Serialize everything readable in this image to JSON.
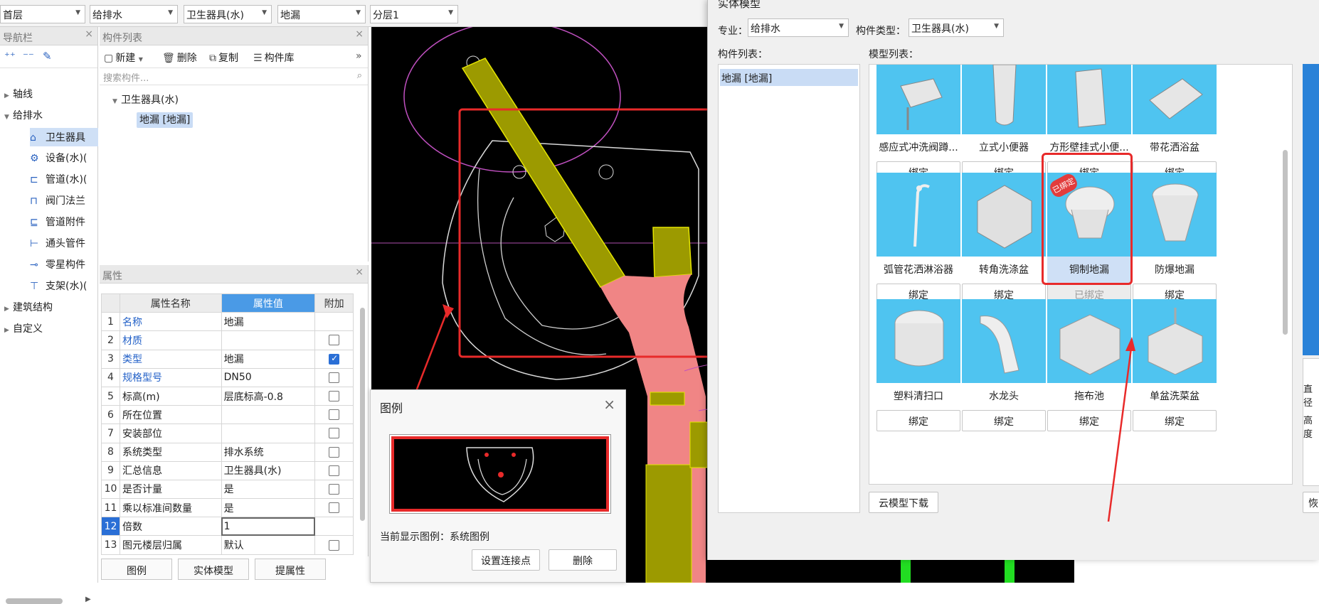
{
  "topbar": {
    "floor": "首层",
    "discipline": "给排水",
    "category": "卫生器具(水)",
    "component": "地漏",
    "sublayer": "分层1"
  },
  "nav": {
    "title": "导航栏",
    "items": [
      {
        "label": "轴线"
      },
      {
        "label": "给排水"
      },
      {
        "label": "卫生器具"
      },
      {
        "label": "设备(水)("
      },
      {
        "label": "管道(水)("
      },
      {
        "label": "阀门法兰"
      },
      {
        "label": "管道附件"
      },
      {
        "label": "通头管件"
      },
      {
        "label": "零星构件"
      },
      {
        "label": "支架(水)("
      },
      {
        "label": "建筑结构"
      },
      {
        "label": "自定义"
      }
    ]
  },
  "component_list": {
    "title": "构件列表",
    "new": "新建",
    "delete": "删除",
    "copy": "复制",
    "library": "构件库",
    "search_placeholder": "搜索构件...",
    "group": "卫生器具(水)",
    "item": "地漏 [地漏]"
  },
  "properties": {
    "title": "属性",
    "col_name": "属性名称",
    "col_value": "属性值",
    "col_extra": "附加",
    "rows": [
      {
        "no": "1",
        "name": "名称",
        "value": "地漏"
      },
      {
        "no": "2",
        "name": "材质",
        "value": ""
      },
      {
        "no": "3",
        "name": "类型",
        "value": "地漏"
      },
      {
        "no": "4",
        "name": "规格型号",
        "value": "DN50"
      },
      {
        "no": "5",
        "name": "标高(m)",
        "value": "层底标高-0.8"
      },
      {
        "no": "6",
        "name": "所在位置",
        "value": ""
      },
      {
        "no": "7",
        "name": "安装部位",
        "value": ""
      },
      {
        "no": "8",
        "name": "系统类型",
        "value": "排水系统"
      },
      {
        "no": "9",
        "name": "汇总信息",
        "value": "卫生器具(水)"
      },
      {
        "no": "10",
        "name": "是否计量",
        "value": "是"
      },
      {
        "no": "11",
        "name": "乘以标准间数量",
        "value": "是"
      },
      {
        "no": "12",
        "name": "倍数",
        "value": "1"
      },
      {
        "no": "13",
        "name": "图元楼层归属",
        "value": "默认"
      }
    ]
  },
  "bottom_tabs": {
    "legend": "图例",
    "entity": "实体模型",
    "extract": "提属性"
  },
  "legend_dialog": {
    "title": "图例",
    "current_prefix": "当前显示图例：",
    "current_value": "系统图例",
    "set_point": "设置连接点",
    "delete": "删除"
  },
  "model_dialog": {
    "title": "实体模型",
    "discipline_label": "专业：",
    "discipline_value": "给排水",
    "type_label": "构件类型：",
    "type_value": "卫生器具(水)",
    "list_label": "构件列表：",
    "model_label": "模型列表：",
    "list_item": "地漏 [地漏]",
    "cloud_download": "云模型下载",
    "side_label_1": "直径",
    "side_label_2": "高度",
    "side_button": "恢",
    "stamp": "已绑定",
    "models": [
      {
        "name": "感应式冲洗阀蹲...",
        "button": "绑定"
      },
      {
        "name": "立式小便器",
        "button": "绑定"
      },
      {
        "name": "方形壁挂式小便...",
        "button": "绑定"
      },
      {
        "name": "带花洒浴盆",
        "button": "绑定"
      },
      {
        "name": "弧管花洒淋浴器",
        "button": "绑定"
      },
      {
        "name": "转角洗涤盆",
        "button": "绑定"
      },
      {
        "name": "铜制地漏",
        "button": "已绑定"
      },
      {
        "name": "防爆地漏",
        "button": "绑定"
      },
      {
        "name": "塑料清扫口",
        "button": "绑定"
      },
      {
        "name": "水龙头",
        "button": "绑定"
      },
      {
        "name": "拖布池",
        "button": "绑定"
      },
      {
        "name": "单盆洗菜盆",
        "button": "绑定"
      }
    ]
  },
  "colors": {
    "highlight_red": "#e82a2a",
    "pipe_yellow": "#9c9a00",
    "pipe_pink": "#f08585",
    "model_thumb": "#4fc4f0",
    "accent_blue": "#2a6fd6"
  }
}
